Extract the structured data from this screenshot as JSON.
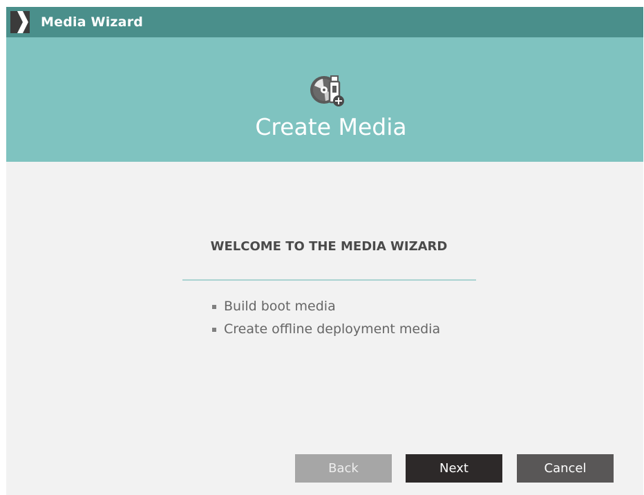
{
  "window": {
    "title": "Media Wizard"
  },
  "banner": {
    "title": "Create Media",
    "icon": "disc-and-usb-icon"
  },
  "welcome": {
    "heading": "WELCOME TO THE MEDIA WIZARD",
    "items": [
      {
        "label": "Build boot media"
      },
      {
        "label": "Create offline deployment media"
      }
    ]
  },
  "buttons": {
    "back": {
      "label": "Back",
      "enabled": false
    },
    "next": {
      "label": "Next",
      "enabled": true
    },
    "cancel": {
      "label": "Cancel",
      "enabled": true
    }
  },
  "colors": {
    "titlebar": "#4a8f8b",
    "banner": "#7fc3c0",
    "content_bg": "#f2f2f2",
    "divider": "#a9d3d1",
    "back_button": "#a6a6a6",
    "next_button": "#2d2929",
    "cancel_button": "#595757"
  }
}
